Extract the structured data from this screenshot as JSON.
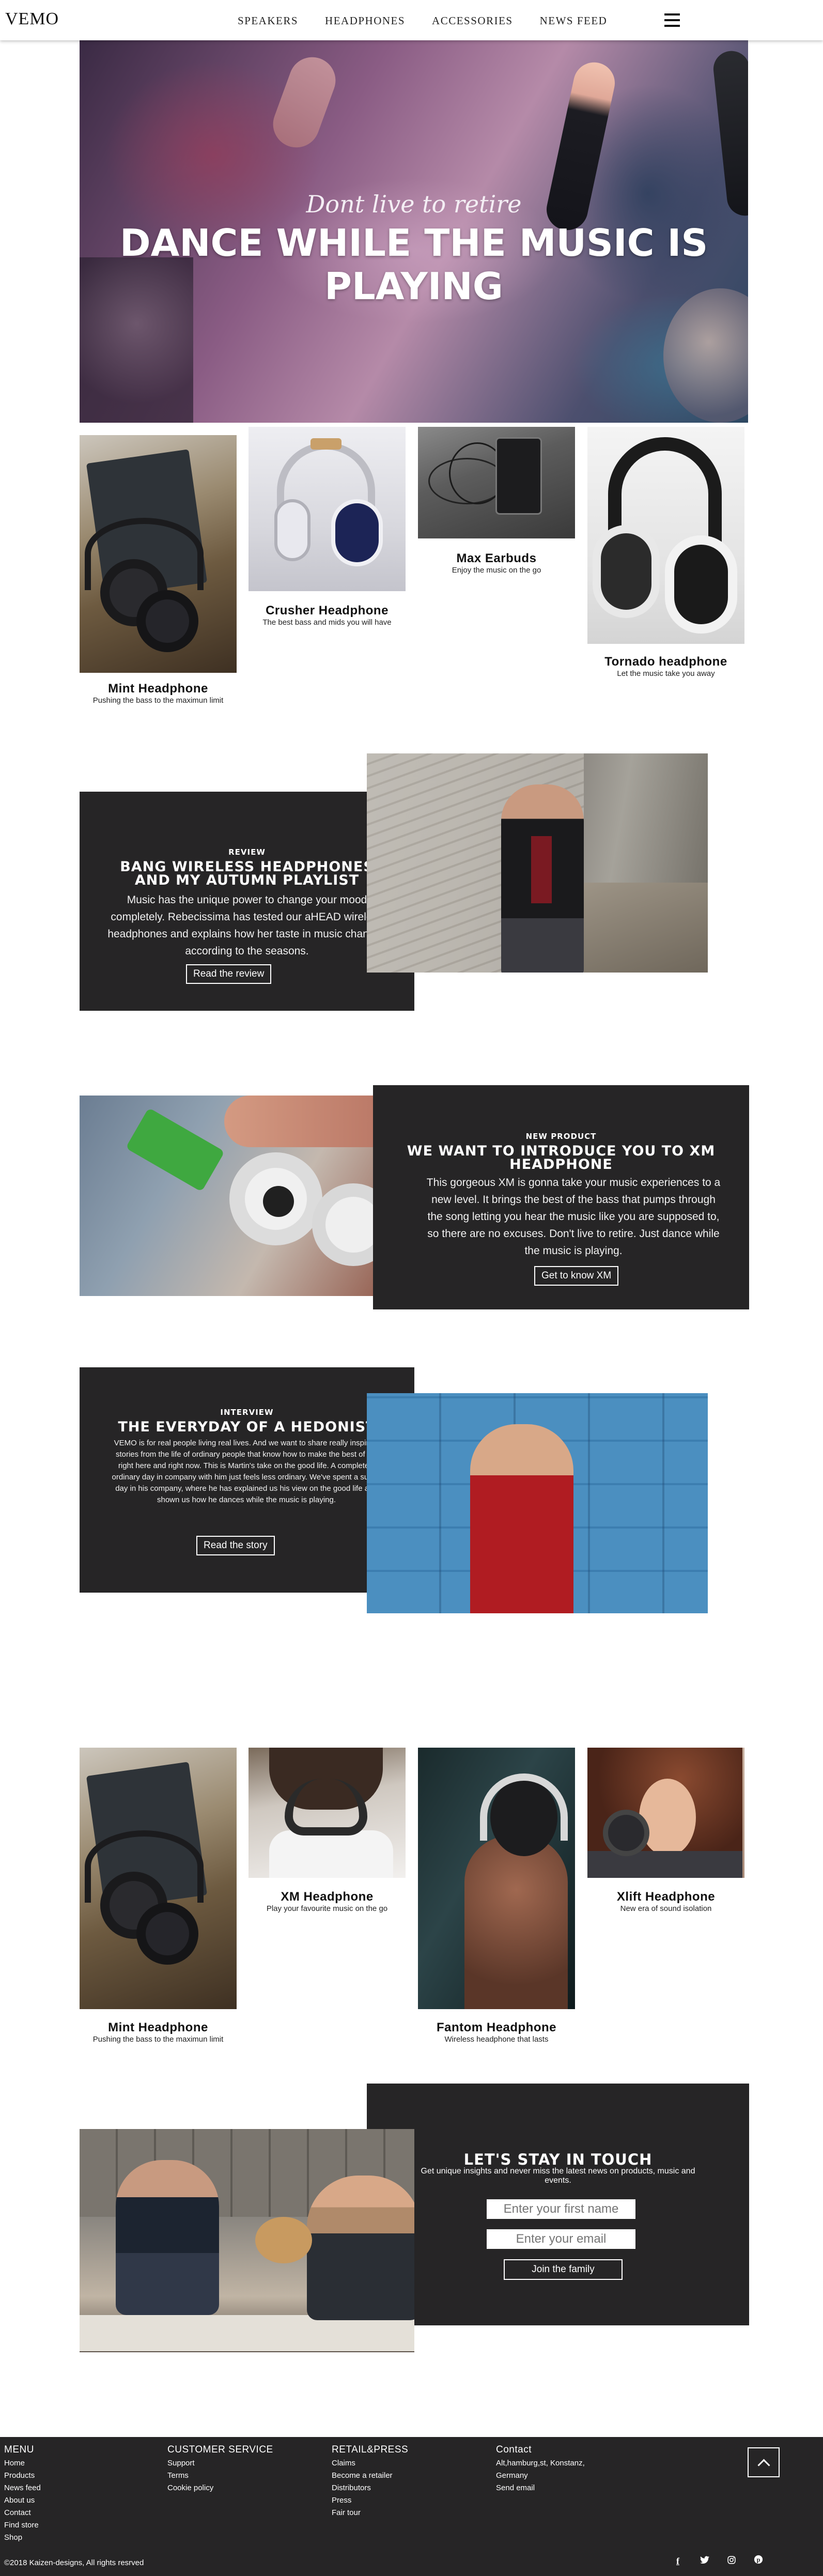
{
  "nav": {
    "logo": "VEMO",
    "items": [
      "SPEAKERS",
      "HEADPHONES",
      "ACCESSORIES",
      "NEWS FEED"
    ]
  },
  "hero": {
    "subtitle": "Dont live to retire",
    "title": "DANCE WHILE THE MUSIC IS PLAYING"
  },
  "products_top": [
    {
      "name": "Mint Headphone",
      "desc": "Pushing the bass to the maximun limit"
    },
    {
      "name": "Crusher Headphone",
      "desc": "The best bass and mids you will have"
    },
    {
      "name": "Max Earbuds",
      "desc": "Enjoy the music on the go"
    },
    {
      "name": "Tornado headphone",
      "desc": "Let the music take you away"
    }
  ],
  "review": {
    "kicker": "REVIEW",
    "title_line1": "BANG WIRELESS HEADPHONES",
    "title_line2": "AND MY AUTUMN PLAYLIST",
    "body": "Music has the unique power to change your mood completely. Rebecissima has tested our aHEAD wireless headphones and explains how her taste in music changes according to the seasons.",
    "button": "Read the review"
  },
  "new_product": {
    "kicker": "NEW PRODUCT",
    "title_line1": "WE WANT TO INTRODUCE YOU TO XM",
    "title_line2": "HEADPHONE",
    "body": "This gorgeous XM is gonna take your music experiences to a new level. It brings the best of the bass that pumps through the song letting you hear the music like you are supposed to, so there are no excuses. Don't live to retire. Just dance while the music is playing.",
    "button": "Get to know XM"
  },
  "interview": {
    "kicker": "INTERVIEW",
    "title": "THE EVERYDAY OF A HEDONIST",
    "body": "VEMO is for real people living real lives. And we want to share really inspiring stories from the life of ordinary people that know how to make the best of life right here and right now. This is Martin's take on the good life. A completely ordinary day in company with him just feels less ordinary. We've spent a sunny day in his company, where he has explained us his view on the good life and shown us how he dances while the music is playing.",
    "button": "Read the story"
  },
  "products_bottom": [
    {
      "name": "Mint Headphone",
      "desc": "Pushing the bass to the maximun limit"
    },
    {
      "name": "XM Headphone",
      "desc": "Play your favourite music on the go"
    },
    {
      "name": "Fantom Headphone",
      "desc": "Wireless headphone that lasts"
    },
    {
      "name": "Xlift Headphone",
      "desc": "New era of sound isolation"
    }
  ],
  "newsletter": {
    "title": "LET'S STAY IN TOUCH",
    "sub_line1": "Get unique insights and never miss the latest news on products, music and",
    "sub_line2": "events.",
    "first_name_placeholder": "Enter your first name",
    "email_placeholder": "Enter your email",
    "button": "Join the family"
  },
  "footer": {
    "menu": {
      "title": "MENU",
      "links": [
        "Home",
        "Products",
        "News feed",
        "About us",
        "Contact",
        "Find store",
        "Shop"
      ]
    },
    "customer": {
      "title": "CUSTOMER SERVICE",
      "links": [
        "Support",
        "Terms",
        "Cookie policy"
      ]
    },
    "retail": {
      "title": "RETAIL&PRESS",
      "links": [
        "Claims",
        "Become a retailer",
        "Distributors",
        "Press",
        "Fair tour"
      ]
    },
    "contact": {
      "title": "Contact",
      "links": [
        "Alt,hamburg,st, Konstanz,",
        "Germany",
        "Send email"
      ]
    },
    "copyright": "©2018 Kaizen-designs, All rights resrved",
    "social_icons": [
      "facebook-icon",
      "twitter-icon",
      "instagram-icon",
      "pinterest-icon"
    ]
  }
}
